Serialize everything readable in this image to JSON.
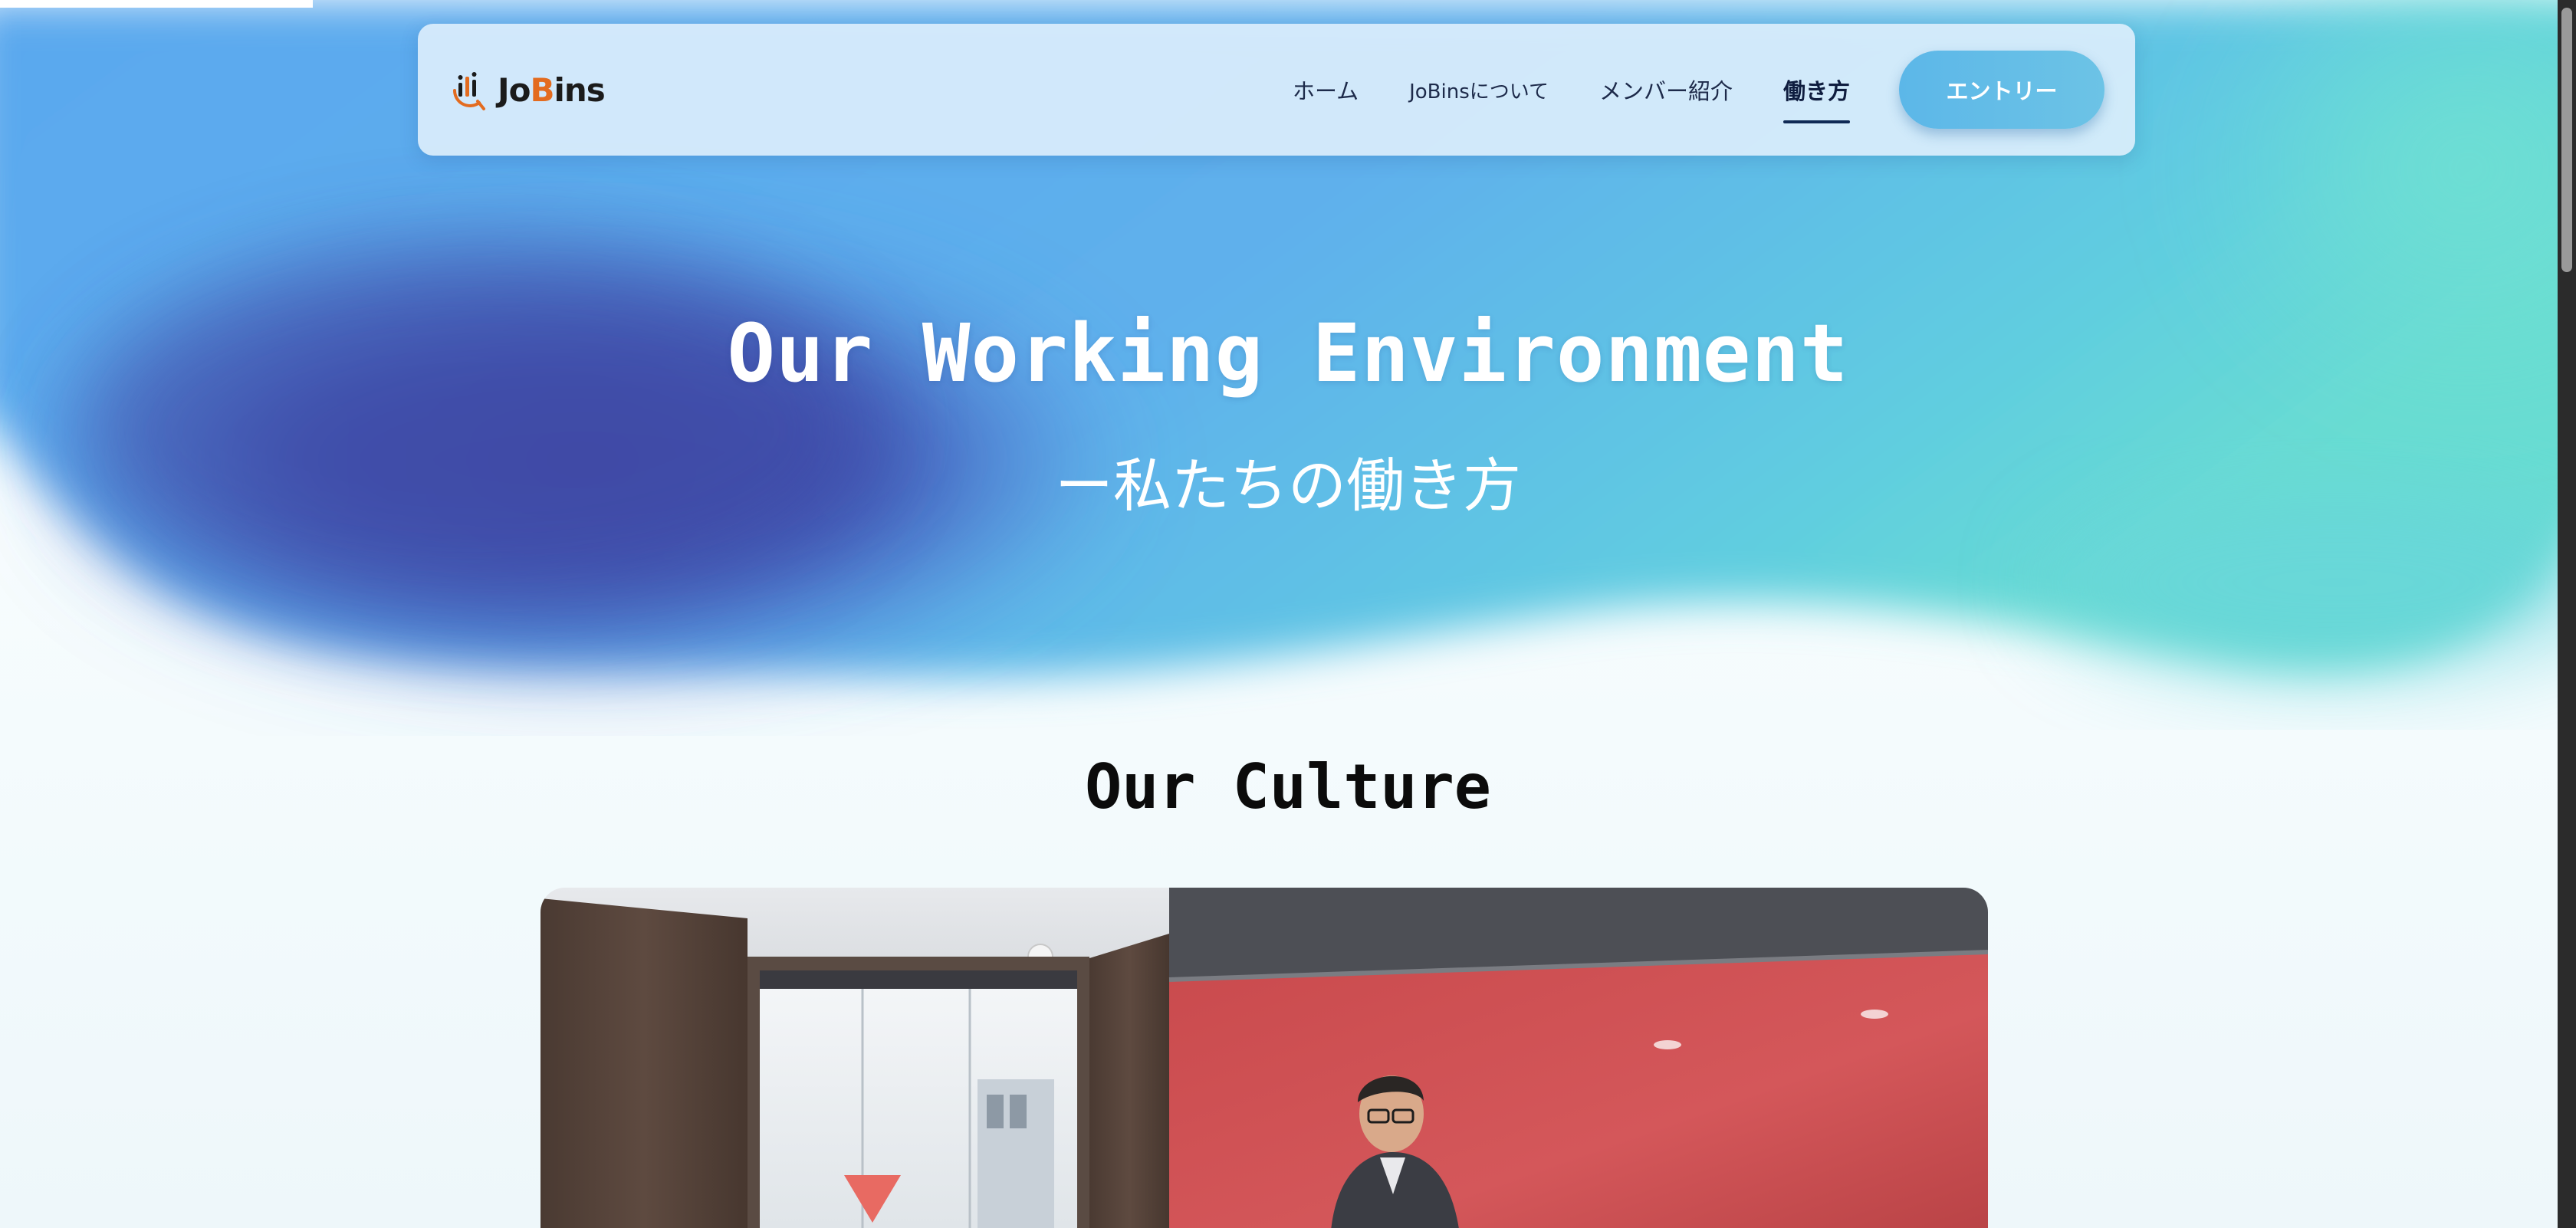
{
  "brand": {
    "logo_text_main": "Jo",
    "logo_text_accent": "B",
    "logo_text_end": "ins"
  },
  "nav": {
    "items": [
      {
        "label": "ホーム",
        "active": false
      },
      {
        "label": "JoBinsについて",
        "active": false
      },
      {
        "label": "メンバー紹介",
        "active": false
      },
      {
        "label": "働き方",
        "active": true
      }
    ],
    "entry_label": "エントリー"
  },
  "hero": {
    "title": "Our Working Environment",
    "subtitle": "ー私たちの働き方"
  },
  "culture": {
    "title": "Our Culture"
  },
  "colors": {
    "hero_dark_blue": "#3f4ea8",
    "hero_sky_blue": "#5baaf0",
    "hero_teal": "#63d6d4",
    "entry_button": "#5cb7e8",
    "logo_accent": "#e36b1f",
    "active_underline": "#0f2a55"
  },
  "icons": {
    "logo": "jobins-logo-icon",
    "scrollbar": "vertical-scrollbar"
  }
}
